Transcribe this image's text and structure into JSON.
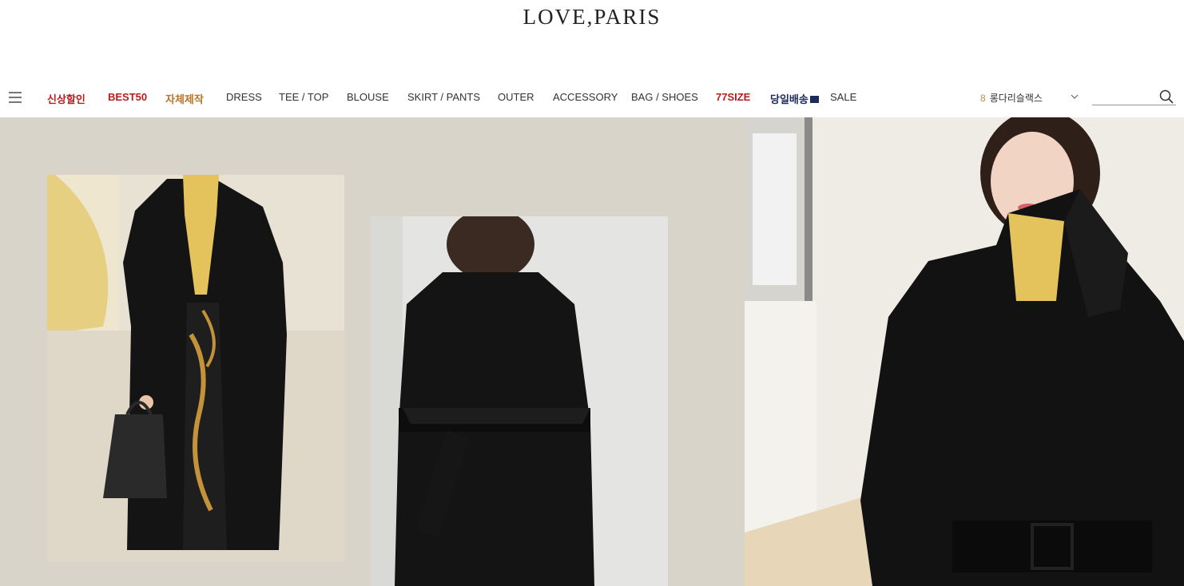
{
  "header": {
    "logo": "LOVE,PARIS"
  },
  "nav": {
    "menu_icon": "hamburger-icon",
    "items": [
      {
        "label": "신상할인",
        "style": "red"
      },
      {
        "label": "BEST50",
        "style": "red"
      },
      {
        "label": "자체제작",
        "style": "gold"
      },
      {
        "label": "DRESS",
        "style": "normal"
      },
      {
        "label": "TEE / TOP",
        "style": "normal"
      },
      {
        "label": "BLOUSE",
        "style": "normal"
      },
      {
        "label": "SKIRT / PANTS",
        "style": "normal"
      },
      {
        "label": "OUTER",
        "style": "normal"
      },
      {
        "label": "ACCESSORY",
        "style": "normal"
      },
      {
        "label": "BAG / SHOES",
        "style": "normal"
      },
      {
        "label": "77SIZE",
        "style": "red"
      },
      {
        "label": "당일배송",
        "style": "navy"
      },
      {
        "label": "SALE",
        "style": "normal"
      }
    ],
    "ticker": {
      "rank": "8",
      "text": "롱다리슬랙스"
    },
    "search": {
      "value": "",
      "placeholder": ""
    }
  },
  "colors": {
    "accent_red": "#b71c1c",
    "accent_gold": "#b8732c",
    "accent_navy": "#1c2a5c",
    "banner_bg": "#d8d4ca"
  }
}
